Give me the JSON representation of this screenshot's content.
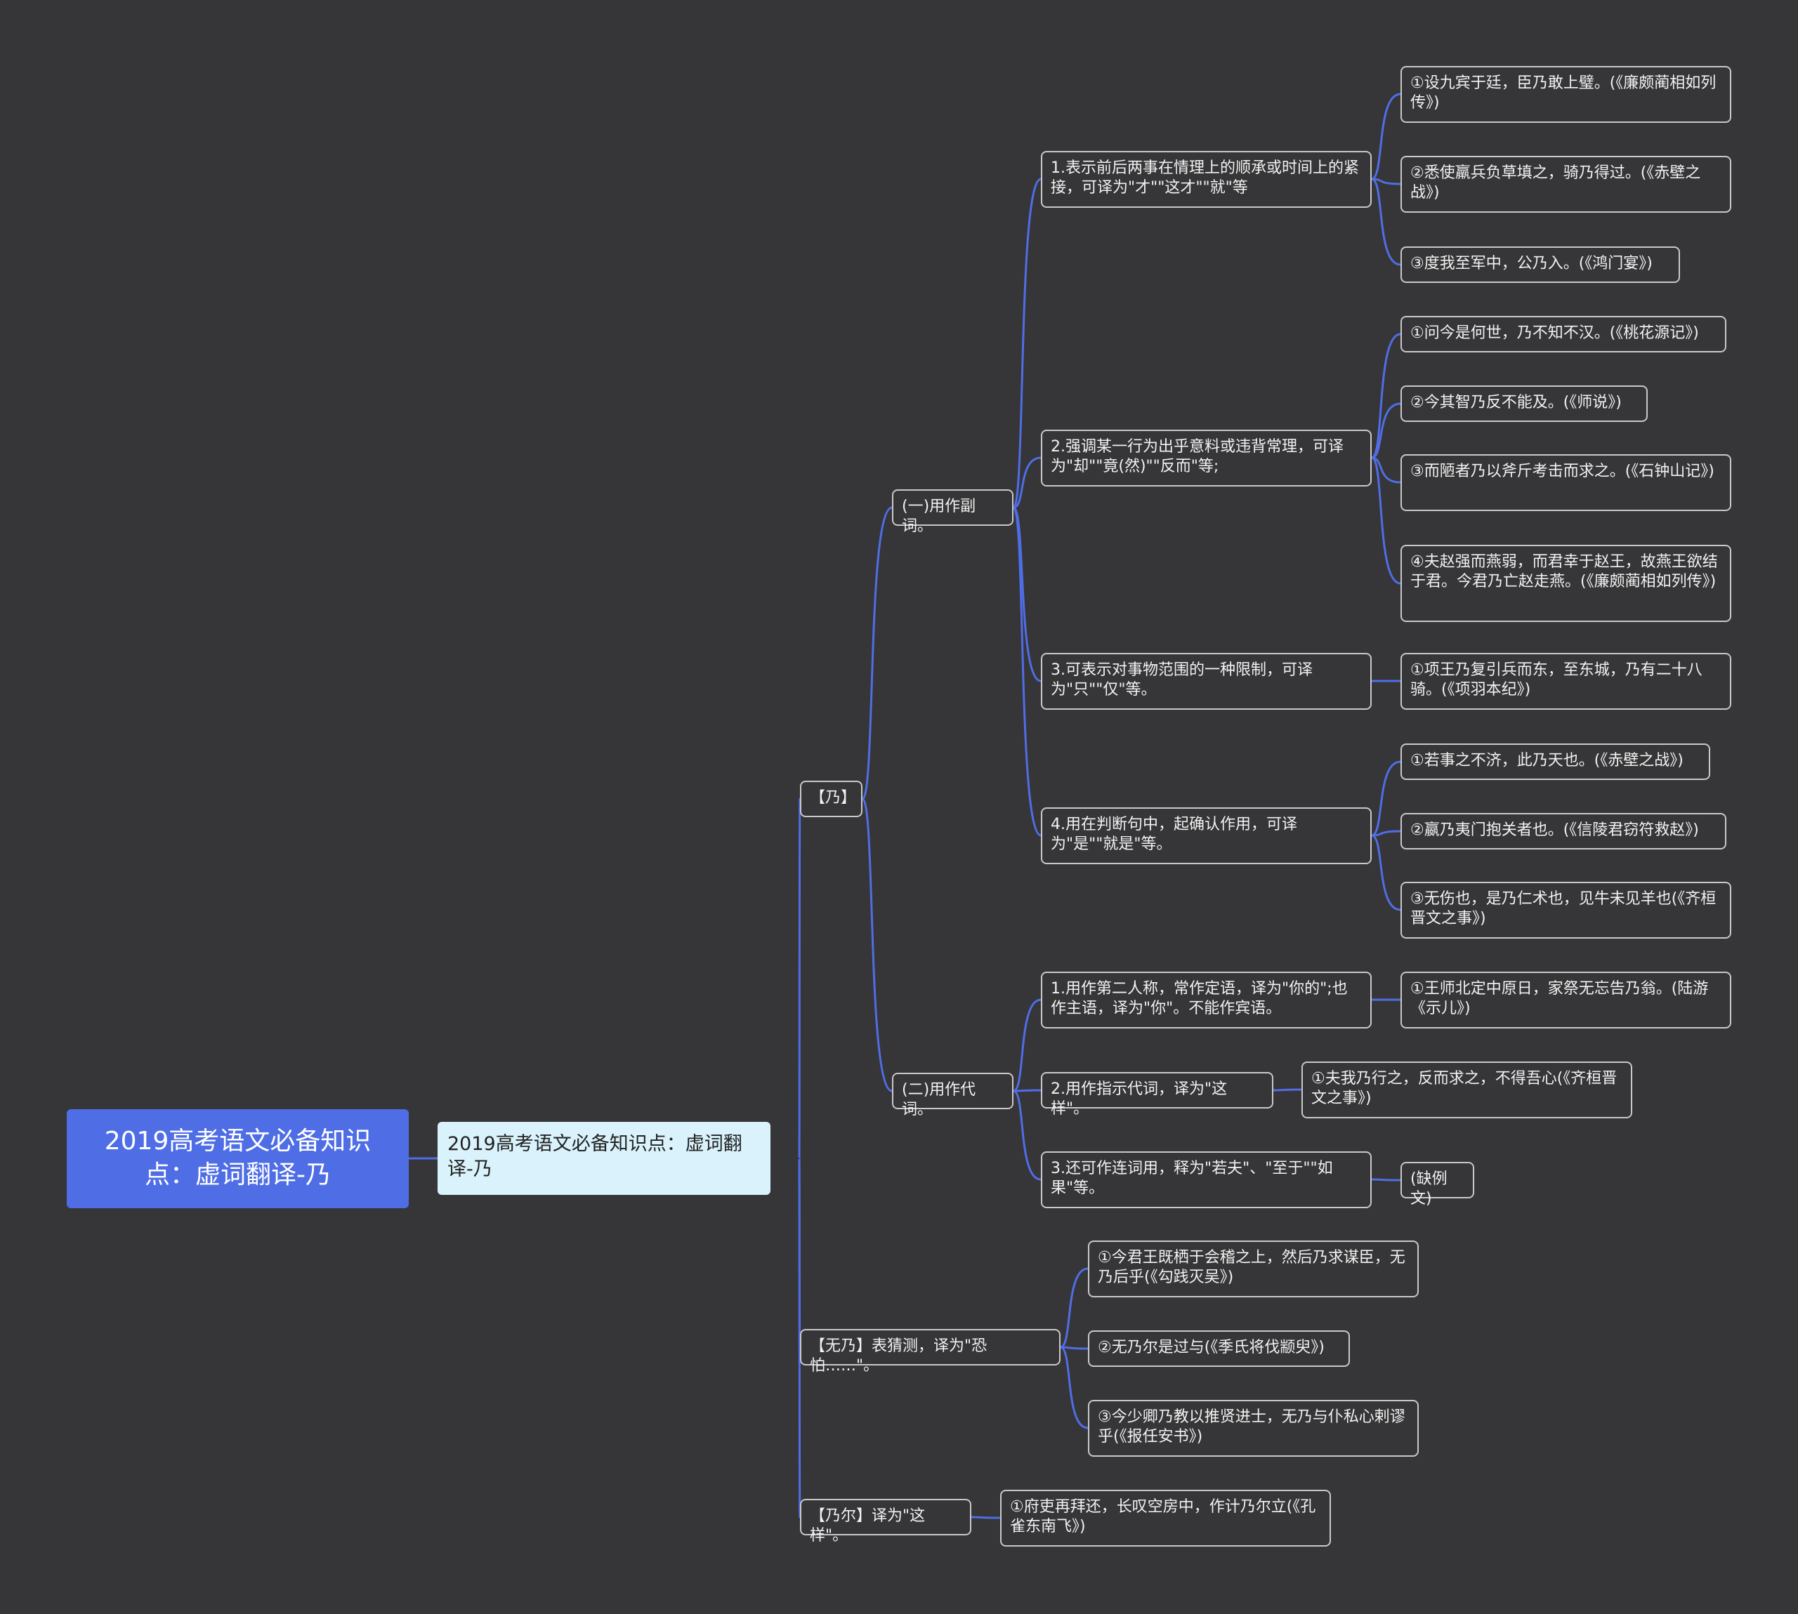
{
  "root": {
    "title": "2019高考语文必备知识点：虚词翻译-乃"
  },
  "main": {
    "title": "2019高考语文必备知识点：虚词翻译-乃"
  },
  "nai": {
    "label": "【乃】",
    "adverb": {
      "label": "(一)用作副词。",
      "items": [
        {
          "label": "1.表示前后两事在情理上的顺承或时间上的紧接，可译为\"才\"\"这才\"\"就\"等",
          "examples": [
            "①设九宾于廷，臣乃敢上璧。(《廉颇蔺相如列传》)",
            "②悉使羸兵负草填之，骑乃得过。(《赤壁之战》)",
            "③度我至军中，公乃入。(《鸿门宴》)"
          ]
        },
        {
          "label": "2.强调某一行为出乎意料或违背常理，可译为\"却\"\"竟(然)\"\"反而\"等;",
          "examples": [
            "①问今是何世，乃不知不汉。(《桃花源记》)",
            "②今其智乃反不能及。(《师说》)",
            "③而陋者乃以斧斤考击而求之。(《石钟山记》)",
            "④夫赵强而燕弱，而君幸于赵王，故燕王欲结于君。今君乃亡赵走燕。(《廉颇蔺相如列传》)"
          ]
        },
        {
          "label": "3.可表示对事物范围的一种限制，可译为\"只\"\"仅\"等。",
          "examples": [
            "①项王乃复引兵而东，至东城，乃有二十八骑。(《项羽本纪》)"
          ]
        },
        {
          "label": "4.用在判断句中，起确认作用，可译为\"是\"\"就是\"等。",
          "examples": [
            "①若事之不济，此乃天也。(《赤壁之战》)",
            "②嬴乃夷门抱关者也。(《信陵君窃符救赵》)",
            "③无伤也，是乃仁术也，见牛未见羊也(《齐桓晋文之事》)"
          ]
        }
      ]
    },
    "pronoun": {
      "label": "(二)用作代词。",
      "items": [
        {
          "label": "1.用作第二人称，常作定语，译为\"你的\";也作主语，译为\"你\"。不能作宾语。",
          "examples": [
            "①王师北定中原日，家祭无忘告乃翁。(陆游《示儿》)"
          ]
        },
        {
          "label": "2.用作指示代词，译为\"这样\"。",
          "examples": [
            "①夫我乃行之，反而求之，不得吾心(《齐桓晋文之事》)"
          ]
        },
        {
          "label": "3.还可作连词用，释为\"若夫\"、\"至于\"\"如果\"等。",
          "examples": [
            "(缺例文)"
          ]
        }
      ]
    }
  },
  "wunai": {
    "label": "【无乃】表猜测，译为\"恐怕……\"。",
    "examples": [
      "①今君王既栖于会稽之上，然后乃求谋臣，无乃后乎(《勾践灭吴》)",
      "②无乃尔是过与(《季氏将伐颛臾》)",
      "③今少卿乃教以推贤进士，无乃与仆私心剌谬乎(《报任安书》)"
    ]
  },
  "naier": {
    "label": "【乃尔】译为\"这样\"。",
    "examples": [
      "①府吏再拜还，长叹空房中，作计乃尔立(《孔雀东南飞》)"
    ]
  },
  "colors": {
    "background": "#363537",
    "link": "#4f6ee6",
    "root_fill": "#4f6ee6",
    "main_fill": "#d9f2fb",
    "node_border": "#c9c9c9"
  }
}
